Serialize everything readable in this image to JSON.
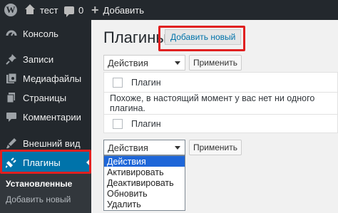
{
  "adminbar": {
    "site_name": "тест",
    "comments_count": "0",
    "new_label": "Добавить"
  },
  "sidebar": {
    "items": [
      {
        "label": "Консоль",
        "icon": "dashboard-icon"
      },
      {
        "label": "Записи",
        "icon": "pin-icon"
      },
      {
        "label": "Медиафайлы",
        "icon": "media-icon"
      },
      {
        "label": "Страницы",
        "icon": "pages-icon"
      },
      {
        "label": "Комментарии",
        "icon": "comments-icon"
      },
      {
        "label": "Внешний вид",
        "icon": "appearance-icon"
      },
      {
        "label": "Плагины",
        "icon": "plugins-icon"
      }
    ],
    "submenu": [
      {
        "label": "Установленные"
      },
      {
        "label": "Добавить новый"
      }
    ]
  },
  "main": {
    "title": "Плагины",
    "add_new_label": "Добавить новый",
    "bulk_top": {
      "selected": "Действия",
      "apply_label": "Применить"
    },
    "table": {
      "column_plugin": "Плагин",
      "empty_message": "Похоже, в настоящий момент у вас нет ни одного плагина.",
      "footer_plugin": "Плагин"
    },
    "bulk_bottom": {
      "selected": "Действия",
      "apply_label": "Применить",
      "options": [
        "Действия",
        "Активировать",
        "Деактивировать",
        "Обновить",
        "Удалить"
      ]
    }
  },
  "colors": {
    "adminbar_bg": "#23282d",
    "active_menu": "#0073aa",
    "highlight": "#e02020",
    "dropdown_selected": "#1e66d8"
  }
}
